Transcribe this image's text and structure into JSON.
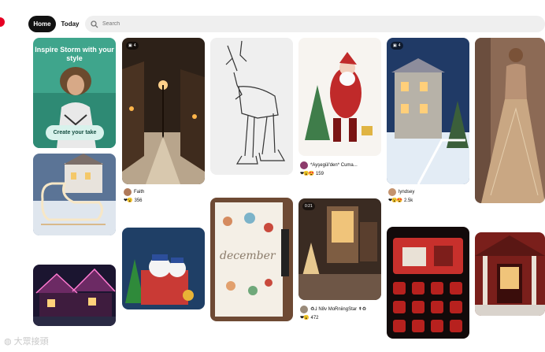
{
  "header": {
    "home_label": "Home",
    "today_label": "Today",
    "search_placeholder": "Search"
  },
  "pins": {
    "inspire": {
      "title": "Inspire Storm with your style",
      "button": "Create your take"
    },
    "snowy_street": {
      "badge": "4",
      "author": "Faith",
      "count": "356"
    },
    "wire_reindeer": {},
    "santa": {
      "author": "*Ayşegül'den* Cuma...",
      "count": "159"
    },
    "winter_house": {
      "badge": "4",
      "author": "lyndsey",
      "count": "2.5k"
    },
    "gold_dress": {},
    "sleigh": {},
    "donald_duck": {},
    "december_journal": {},
    "shop_door": {
      "badge": "0:21",
      "author": "♻⅃ N8v MoRniingStar ⇞♻",
      "count": "472"
    },
    "red_homescreen": {},
    "christmas_lights_house": {},
    "red_entrance": {}
  },
  "watermark": "大眾接頭"
}
